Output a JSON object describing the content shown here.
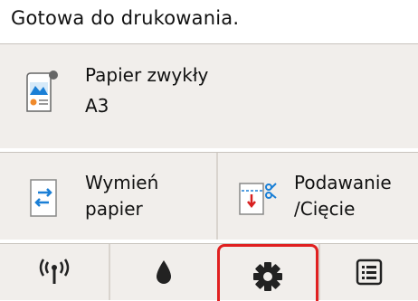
{
  "status": {
    "text": "Gotowa do drukowania."
  },
  "paper": {
    "name": "Papier zwykły",
    "size": "A3",
    "icon": "paper-icon"
  },
  "actions": [
    {
      "line1": "Wymień",
      "line2": "papier",
      "icon": "swap-paper-icon"
    },
    {
      "line1": "Podawanie",
      "line2": "/Cięcie",
      "icon": "feed-cut-icon"
    }
  ],
  "toolbar": {
    "items": [
      "wifi-icon",
      "ink-drop-icon",
      "gear-icon",
      "list-icon"
    ],
    "selected": "gear-icon"
  },
  "colors": {
    "panel_bg": "#f1eeeb",
    "separator": "#c8c3bd",
    "highlight": "#e02020",
    "accent_blue": "#1a7fd6"
  }
}
